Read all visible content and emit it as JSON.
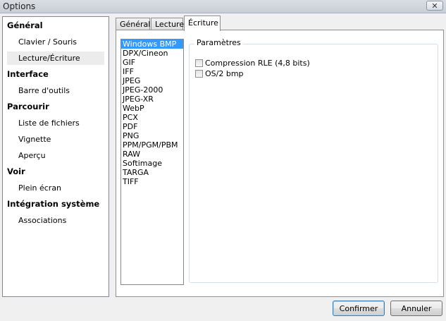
{
  "window": {
    "title": "Options",
    "close_glyph": "✕"
  },
  "tree": {
    "groups": [
      {
        "label": "Général",
        "items": [
          "Clavier / Souris",
          "Lecture/Écriture"
        ]
      },
      {
        "label": "Interface",
        "items": [
          "Barre d'outils"
        ]
      },
      {
        "label": "Parcourir",
        "items": [
          "Liste de fichiers",
          "Vignette",
          "Aperçu"
        ]
      },
      {
        "label": "Voir",
        "items": [
          "Plein écran"
        ]
      },
      {
        "label": "Intégration système",
        "items": [
          "Associations"
        ]
      }
    ],
    "selected_item": "Lecture/Écriture"
  },
  "tabs": [
    {
      "label": "Général"
    },
    {
      "label": "Lecture"
    },
    {
      "label": "Écriture"
    }
  ],
  "active_tab": "Écriture",
  "formats": {
    "items": [
      "Windows BMP",
      "DPX/Cineon",
      "GIF",
      "IFF",
      "JPEG",
      "JPEG-2000",
      "JPEG-XR",
      "WebP",
      "PCX",
      "PDF",
      "PNG",
      "PPM/PGM/PBM",
      "RAW",
      "Softimage",
      "TARGA",
      "TIFF"
    ],
    "selected": "Windows BMP"
  },
  "parameters": {
    "legend": "Paramètres",
    "checkboxes": [
      {
        "label": "Compression RLE (4,8 bits)",
        "checked": false
      },
      {
        "label": "OS/2 bmp",
        "checked": false
      }
    ]
  },
  "buttons": {
    "ok": "Confirmer",
    "cancel": "Annuler"
  },
  "colors": {
    "selection": "#3399ff",
    "tree_selected": "#ececec"
  }
}
